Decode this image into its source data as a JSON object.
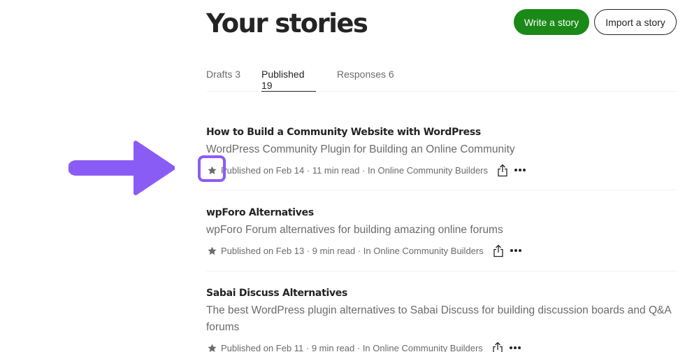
{
  "header": {
    "title": "Your stories",
    "write_label": "Write a story",
    "import_label": "Import a story"
  },
  "tabs": [
    {
      "label": "Drafts 3",
      "active": false
    },
    {
      "label": "Published 19",
      "active": true
    },
    {
      "label": "Responses 6",
      "active": false
    }
  ],
  "stories": [
    {
      "title": "How to Build a Community Website with WordPress",
      "subtitle": "WordPress Community Plugin for Building an Online Community",
      "meta": "Published on Feb 14 · 11 min read · In Online Community Builders"
    },
    {
      "title": "wpForo Alternatives",
      "subtitle": "wpForo Forum alternatives for building amazing online forums",
      "meta": "Published on Feb 13 · 9 min read · In Online Community Builders"
    },
    {
      "title": "Sabai Discuss Alternatives",
      "subtitle": "The best WordPress plugin alternatives to Sabai Discuss for building discussion boards and Q&A forums",
      "meta": "Published on Feb 11 · 9 min read · In Online Community Builders"
    }
  ],
  "icons": {
    "star": "star-icon",
    "share": "share-icon",
    "more": "more-options-icon"
  },
  "colors": {
    "brand_green": "#1a8917",
    "annotation_purple": "#8a5cf6",
    "text_primary": "#242424",
    "text_secondary": "#6b6b6b",
    "divider": "#f2f2f2"
  }
}
